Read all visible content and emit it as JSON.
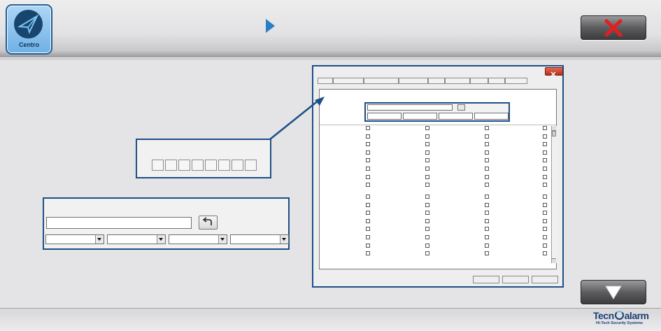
{
  "header": {
    "app_button_label": "Centro",
    "app_icon": "paper-plane-icon",
    "breadcrumb_icon": "chevron-right-icon",
    "close_icon": "close-x-icon"
  },
  "footer": {
    "down_icon": "triangle-down-icon",
    "brand_name_prefix": "Tecn",
    "brand_name_suffix": "alarm",
    "brand_tagline": "Hi-Tech Security Systems"
  },
  "colors": {
    "accent": "#1d4f86",
    "close_red": "#e02020",
    "logo_blue": "#6fb0e6"
  }
}
